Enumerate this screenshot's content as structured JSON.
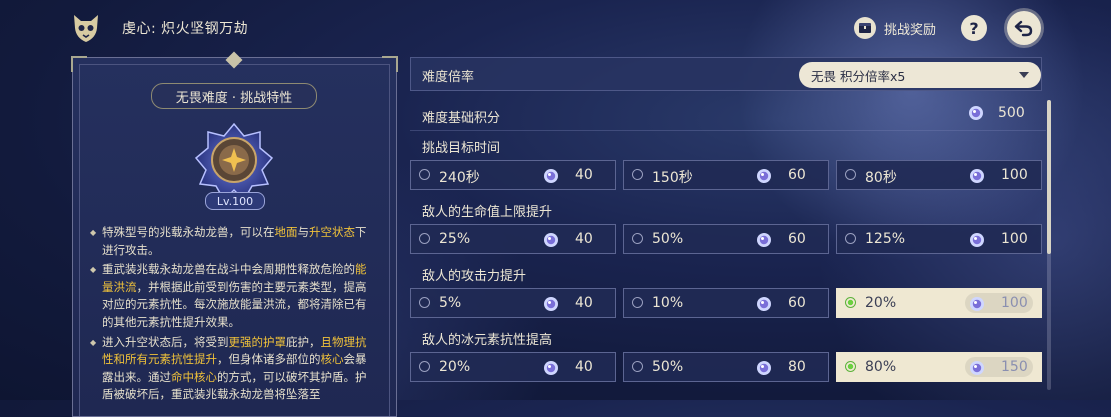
{
  "header": {
    "title": "虔心: 炽火坚钢万劫",
    "reward_label": "挑战奖励",
    "help_label": "?"
  },
  "left_panel": {
    "tag": "无畏难度 · 挑战特性",
    "level": "Lv.100",
    "desc1_a": "特殊型号的兆载永劫龙兽，可以在",
    "desc1_hl1": "地面",
    "desc1_b": "与",
    "desc1_hl2": "升空状态",
    "desc1_c": "下进行攻击。",
    "desc2_a": "重武装兆载永劫龙兽在战斗中会周期性释放危险的",
    "desc2_hl": "能量洪流",
    "desc2_b": "，并根据此前受到伤害的主要元素类型，提高对应的元素抗性。每次施放能量洪流，都将清除已有的其他元素抗性提升效果。",
    "desc3_a": "进入升空状态后，将受到",
    "desc3_hl1": "更强的护罩",
    "desc3_b": "庇护，",
    "desc3_hl2": "且物理抗性和所有元素抗性提升",
    "desc3_c": "，但身体诸多部位的",
    "desc3_hl3": "核心",
    "desc3_d": "会暴露出来。通过",
    "desc3_hl4": "命中核心",
    "desc3_e": "的方式，可以破坏其护盾。护盾被破坏后，重武装兆载永劫龙兽将坠落至"
  },
  "difficulty": {
    "label": "难度倍率",
    "dropdown_value": "无畏  积分倍率x5"
  },
  "base_score": {
    "label": "难度基础积分",
    "value": "500"
  },
  "sections": [
    {
      "title": "挑战目标时间",
      "options": [
        {
          "label": "240秒",
          "points": "40",
          "selected": false
        },
        {
          "label": "150秒",
          "points": "60",
          "selected": false
        },
        {
          "label": "80秒",
          "points": "100",
          "selected": false
        }
      ]
    },
    {
      "title": "敌人的生命值上限提升",
      "options": [
        {
          "label": "25%",
          "points": "40",
          "selected": false
        },
        {
          "label": "50%",
          "points": "60",
          "selected": false
        },
        {
          "label": "125%",
          "points": "100",
          "selected": false
        }
      ]
    },
    {
      "title": "敌人的攻击力提升",
      "options": [
        {
          "label": "5%",
          "points": "40",
          "selected": false
        },
        {
          "label": "10%",
          "points": "60",
          "selected": false
        },
        {
          "label": "20%",
          "points": "100",
          "selected": true
        }
      ]
    },
    {
      "title": "敌人的冰元素抗性提高",
      "options": [
        {
          "label": "20%",
          "points": "40",
          "selected": false
        },
        {
          "label": "50%",
          "points": "80",
          "selected": false
        },
        {
          "label": "80%",
          "points": "150",
          "selected": true
        }
      ]
    }
  ],
  "colors": {
    "highlight": "#f0c23a",
    "selected_bg": "#efe8d2",
    "selected_radio": "#6bd040"
  },
  "icons": [
    "cat-mask-logo-icon",
    "reward-chest-icon",
    "help-icon",
    "back-arrow-icon",
    "boss-emblem-icon",
    "gem-point-icon",
    "radio-icon"
  ]
}
